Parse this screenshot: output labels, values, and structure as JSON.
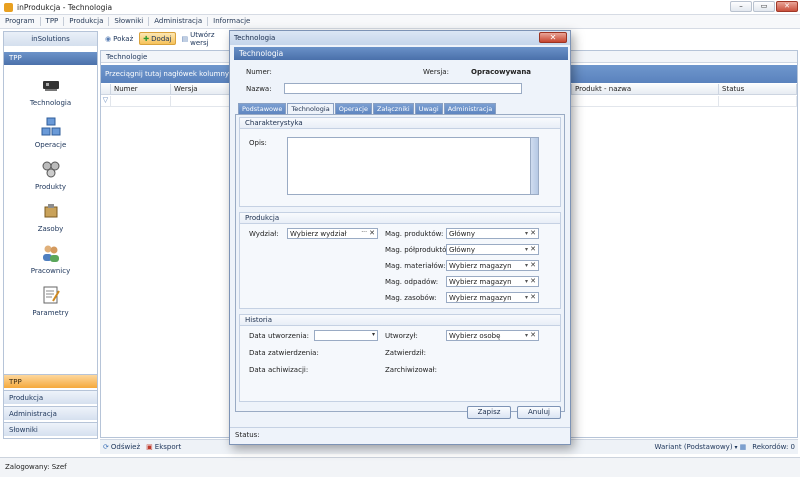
{
  "window": {
    "title": "inProdukcja - Technologia",
    "min": "–",
    "max": "▭",
    "close": "✕"
  },
  "menu": [
    "Program",
    "TPP",
    "Produkcja",
    "Słowniki",
    "Administracja",
    "Informacje"
  ],
  "left_panel": {
    "header": "inSolutions",
    "section": "TPP",
    "items": [
      {
        "label": "Technologia",
        "icon": "chip-icon"
      },
      {
        "label": "Operacje",
        "icon": "operations-icon"
      },
      {
        "label": "Produkty",
        "icon": "products-icon"
      },
      {
        "label": "Zasoby",
        "icon": "resources-icon"
      },
      {
        "label": "Pracownicy",
        "icon": "workers-icon"
      },
      {
        "label": "Parametry",
        "icon": "parameters-icon"
      }
    ],
    "groups": [
      "TPP",
      "Produkcja",
      "Administracja",
      "Słowniki"
    ]
  },
  "toolbar": {
    "show": "Pokaż",
    "add": "Dodaj",
    "create": "Utwórz wersj"
  },
  "grid": {
    "header": "Technologie",
    "group_hint": "Przeciągnij tutaj nagłówek kolumny, jeśli ma",
    "columns": [
      "Numer",
      "Wersja",
      "Produkt - nazwa",
      "Status"
    ]
  },
  "bottom": {
    "refresh": "Odśwież",
    "export": "Eksport",
    "variant": "Wariant (Podstawowy)",
    "records": "Rekordów: 0"
  },
  "status": "Zalogowany: Szef",
  "modal": {
    "title": "Technologia",
    "header": "Technologia",
    "numer_label": "Numer:",
    "wersja_label": "Wersja:",
    "wersja_value": "Opracowywana",
    "nazwa_label": "Nazwa:",
    "tabs": [
      "Podstawowe",
      "Technologia",
      "Operacje",
      "Załączniki",
      "Uwagi",
      "Administracja"
    ],
    "charakterystyka": {
      "title": "Charakterystyka",
      "opis_label": "Opis:"
    },
    "produkcja": {
      "title": "Produkcja",
      "wydzial_label": "Wydział:",
      "wydzial_value": "Wybierz wydział",
      "mag": [
        {
          "label": "Mag. produktów:",
          "value": "Główny"
        },
        {
          "label": "Mag. półproduktów:",
          "value": "Główny"
        },
        {
          "label": "Mag. materiałów:",
          "value": "Wybierz magazyn"
        },
        {
          "label": "Mag. odpadów:",
          "value": "Wybierz magazyn"
        },
        {
          "label": "Mag. zasobów:",
          "value": "Wybierz magazyn"
        }
      ]
    },
    "historia": {
      "title": "Historia",
      "data_utworzenia": "Data utworzenia:",
      "data_zatwierdzenia": "Data zatwierdzenia:",
      "data_archiwizacji": "Data achiwizacji:",
      "utworzyl": "Utworzył:",
      "utworzyl_value": "Wybierz osobę",
      "zatwierdzil": "Zatwierdził:",
      "zarchiwizowal": "Zarchiwizował:"
    },
    "save": "Zapisz",
    "cancel": "Anuluj",
    "status_label": "Status:"
  }
}
